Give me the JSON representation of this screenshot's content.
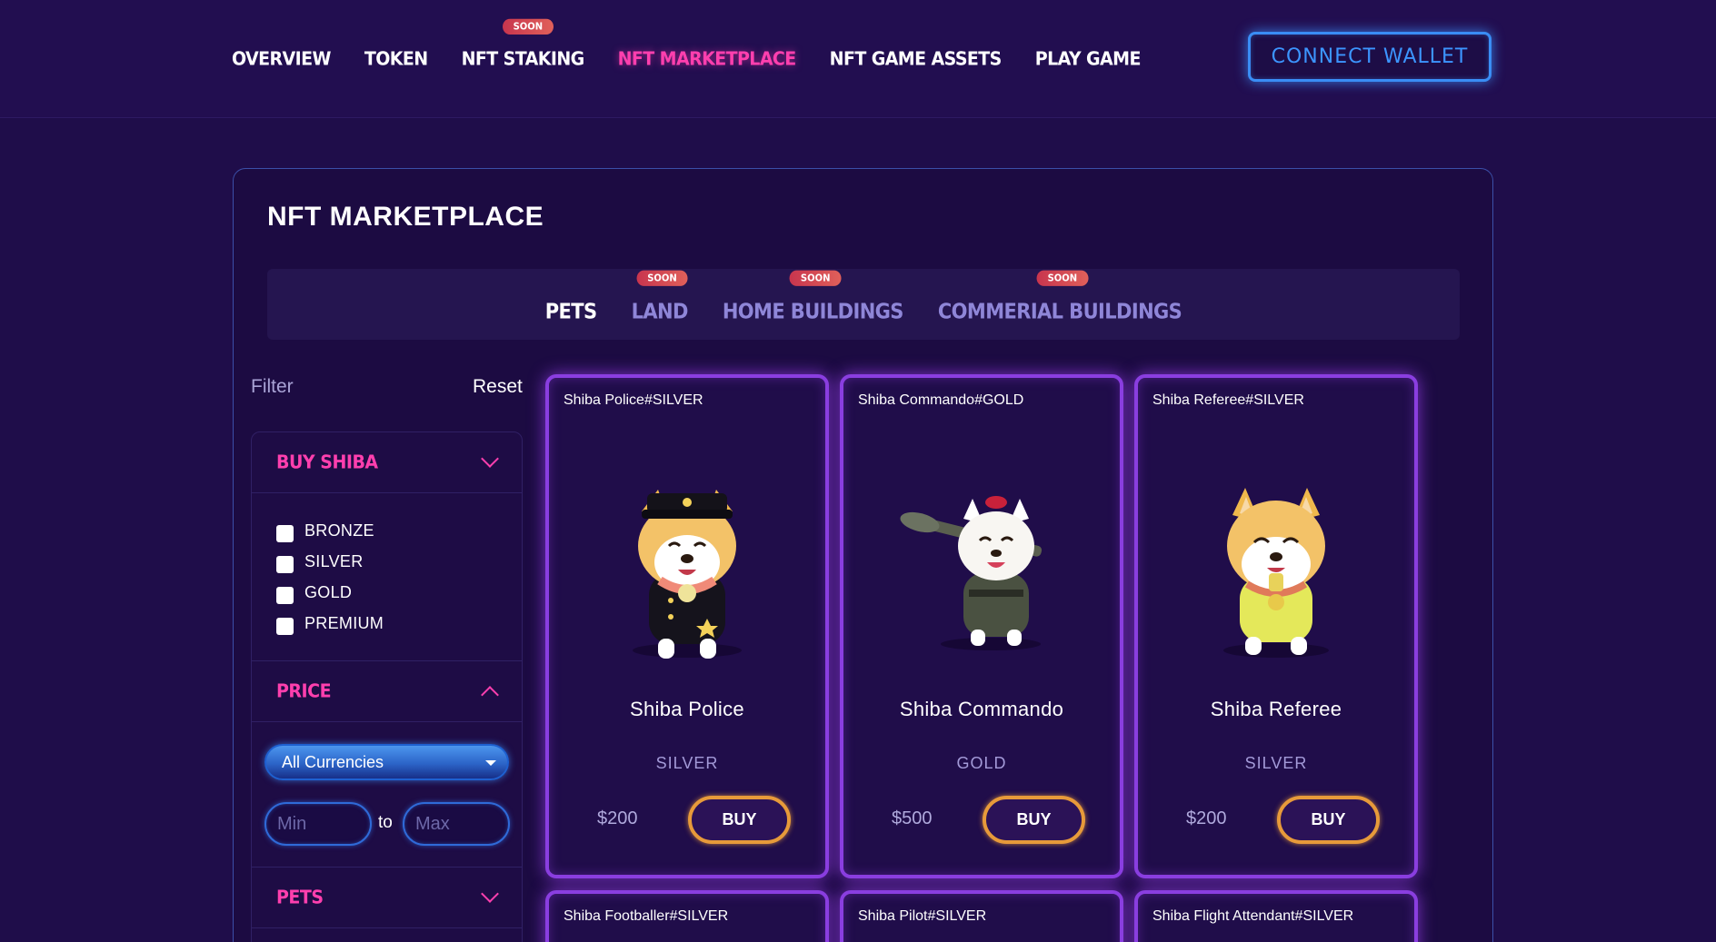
{
  "nav": {
    "items": [
      {
        "label": "OVERVIEW"
      },
      {
        "label": "TOKEN"
      },
      {
        "label": "NFT STAKING",
        "badge": "SOON"
      },
      {
        "label": "NFT MARKETPLACE",
        "active": true
      },
      {
        "label": "NFT GAME ASSETS"
      },
      {
        "label": "PLAY GAME"
      }
    ],
    "connect_wallet": "CONNECT WALLET"
  },
  "page": {
    "title": "NFT MARKETPLACE"
  },
  "categories": [
    {
      "label": "PETS",
      "active": true
    },
    {
      "label": "LAND",
      "badge": "SOON"
    },
    {
      "label": "HOME BUILDINGS",
      "badge": "SOON"
    },
    {
      "label": "COMMERIAL BUILDINGS",
      "badge": "SOON"
    }
  ],
  "filter": {
    "title": "Filter",
    "reset": "Reset",
    "buy_shiba": {
      "title": "BUY SHIBA",
      "options": [
        "BRONZE",
        "SILVER",
        "GOLD",
        "PREMIUM"
      ]
    },
    "price": {
      "title": "PRICE",
      "currency": "All Currencies",
      "min_placeholder": "Min",
      "to": "to",
      "max_placeholder": "Max"
    },
    "pets": {
      "title": "PETS"
    }
  },
  "cards": [
    {
      "code": "Shiba Police#SILVER",
      "name": "Shiba Police",
      "tier": "SILVER",
      "price": "$200",
      "buy": "BUY",
      "icon": "shiba-police-image"
    },
    {
      "code": "Shiba Commando#GOLD",
      "name": "Shiba Commando",
      "tier": "GOLD",
      "price": "$500",
      "buy": "BUY",
      "icon": "shiba-commando-image"
    },
    {
      "code": "Shiba Referee#SILVER",
      "name": "Shiba Referee",
      "tier": "SILVER",
      "price": "$200",
      "buy": "BUY",
      "icon": "shiba-referee-image"
    },
    {
      "code": "Shiba Footballer#SILVER"
    },
    {
      "code": "Shiba Pilot#SILVER"
    },
    {
      "code": "Shiba Flight Attendant#SILVER"
    }
  ],
  "colors": {
    "background": "#1f0d4a",
    "accent_pink": "#ff3fae",
    "accent_blue": "#3c95ff",
    "card_border": "#8a3ee0",
    "buy_border": "#e79a3a",
    "soon_badge": "#d4474f"
  }
}
